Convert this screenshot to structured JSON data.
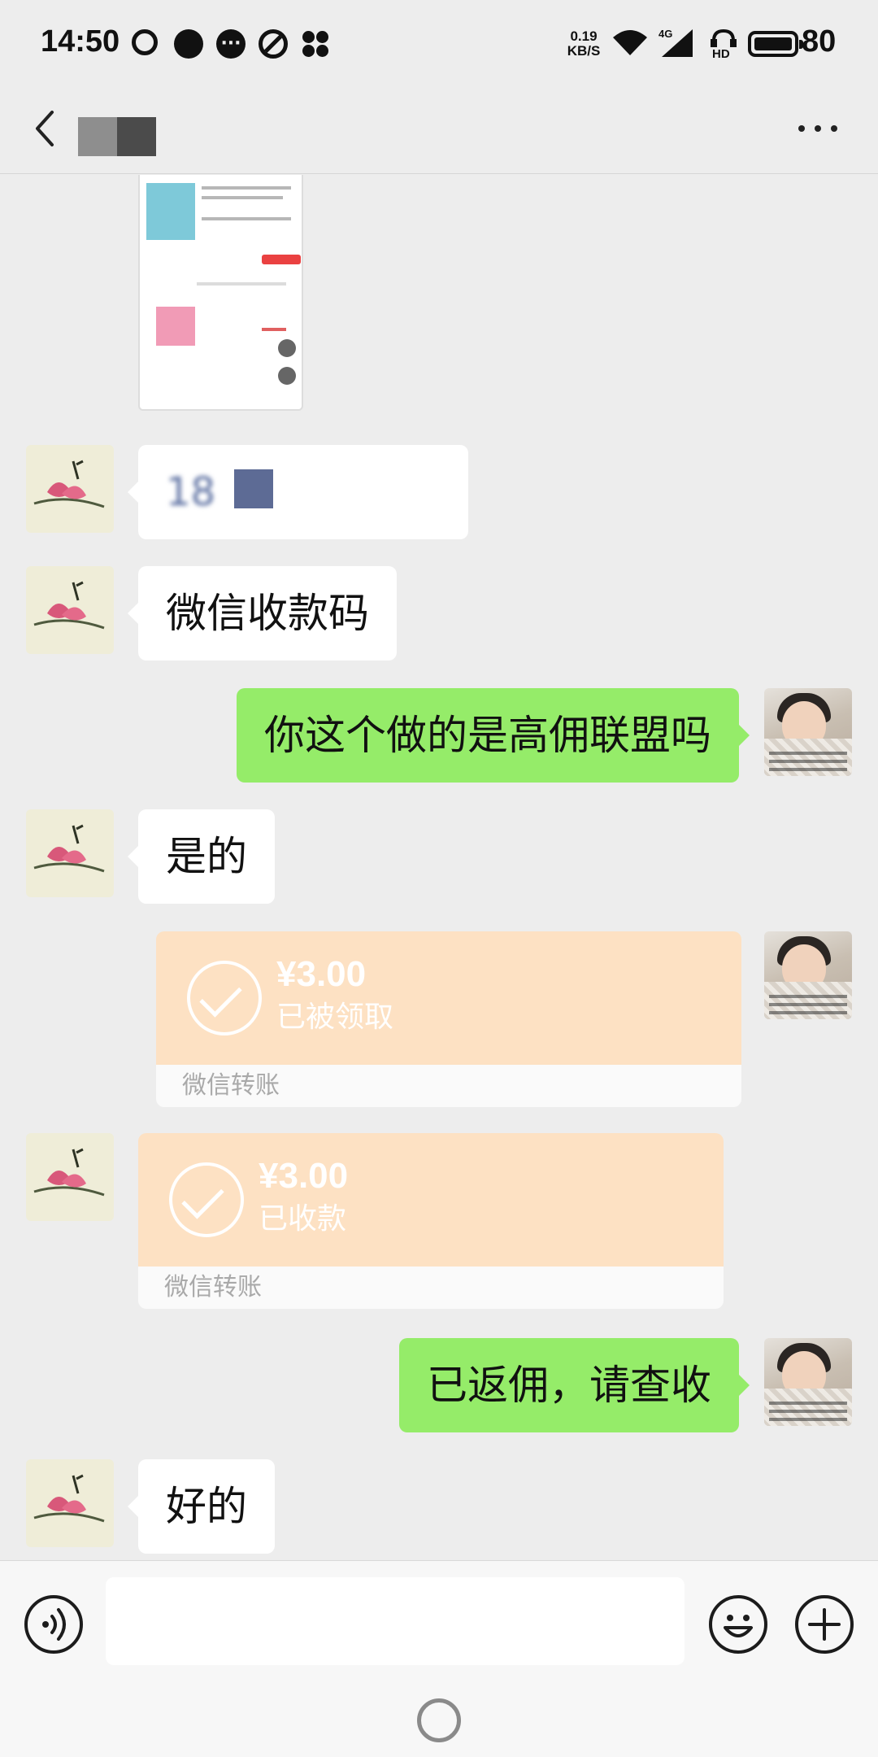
{
  "status_bar": {
    "time": "14:50",
    "net_speed_value": "0.19",
    "net_speed_unit": "KB/S",
    "network_type": "4G",
    "hd_label": "HD",
    "battery_level": "80"
  },
  "header": {
    "back_icon": "chevron-left-icon",
    "more_icon": "more-horizontal-icon"
  },
  "messages": [
    {
      "side": "in",
      "type": "image"
    },
    {
      "side": "in",
      "type": "masked-text",
      "text": "18"
    },
    {
      "side": "in",
      "type": "text",
      "text": "微信收款码"
    },
    {
      "side": "out",
      "type": "text",
      "text": "你这个做的是高佣联盟吗"
    },
    {
      "side": "in",
      "type": "text",
      "text": "是的"
    },
    {
      "side": "out",
      "type": "transfer",
      "amount": "¥3.00",
      "status": "已被领取",
      "label": "微信转账"
    },
    {
      "side": "in",
      "type": "transfer",
      "amount": "¥3.00",
      "status": "已收款",
      "label": "微信转账"
    },
    {
      "side": "out",
      "type": "text",
      "text": "已返佣，请查收"
    },
    {
      "side": "in",
      "type": "text",
      "text": "好的"
    }
  ],
  "input_bar": {
    "value": "",
    "voice_icon": "voice-icon",
    "emoji_icon": "emoji-icon",
    "plus_icon": "plus-icon"
  },
  "colors": {
    "background": "#ededed",
    "outgoing_bubble": "#95ec69",
    "incoming_bubble": "#ffffff",
    "transfer_card": "#fde1c3"
  }
}
